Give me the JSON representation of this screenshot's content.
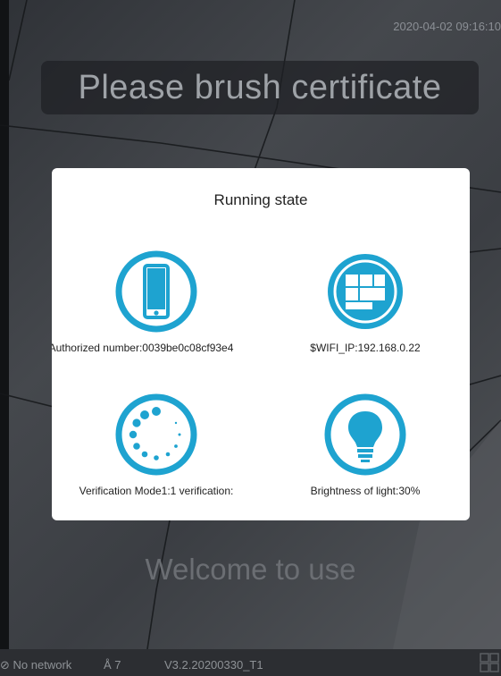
{
  "status_bar": {
    "timestamp": "2020-04-02 09:16:10"
  },
  "banner": {
    "text": "Please brush certificate"
  },
  "dialog": {
    "title": "Running state",
    "items": [
      {
        "icon": "device-icon",
        "label": "Authorized number:0039be0c08cf93e4"
      },
      {
        "icon": "network-blocks-icon",
        "label": "$WIFI_IP:192.168.0.22"
      },
      {
        "icon": "loading-spinner-icon",
        "label": "Verification Mode1:1 verification:"
      },
      {
        "icon": "lightbulb-icon",
        "label": "Brightness of light:30%"
      }
    ]
  },
  "welcome": {
    "text": "Welcome to use"
  },
  "bottom_bar": {
    "network_status": "No network",
    "user_count": "7",
    "version": "V3.2.20200330_T1"
  },
  "colors": {
    "accent": "#1ea3d0",
    "dialog_bg": "#ffffff"
  }
}
